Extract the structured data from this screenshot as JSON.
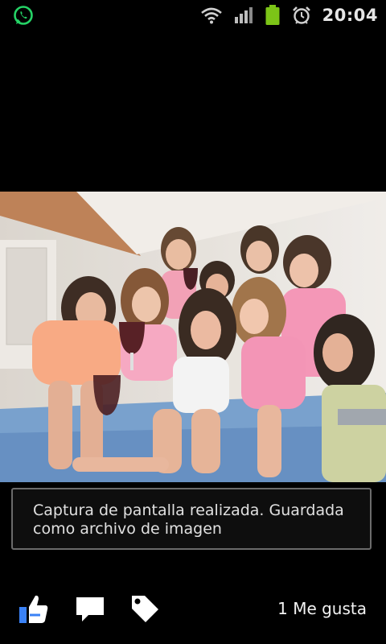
{
  "status_bar": {
    "time": "20:04",
    "icons": [
      "whatsapp-icon",
      "wifi-icon",
      "signal-icon",
      "battery-icon",
      "alarm-icon"
    ],
    "colors": {
      "whatsapp": "#25d366",
      "battery": "#7cc417"
    }
  },
  "photo": {
    "description_icon": "photo-image"
  },
  "toast": {
    "message": "Captura de pantalla realizada. Guardada como archivo de imagen"
  },
  "action_bar": {
    "icons": [
      "like-icon",
      "comment-icon",
      "tag-icon"
    ],
    "likes_label": "1 Me gusta",
    "accent": "#3b82f6"
  }
}
